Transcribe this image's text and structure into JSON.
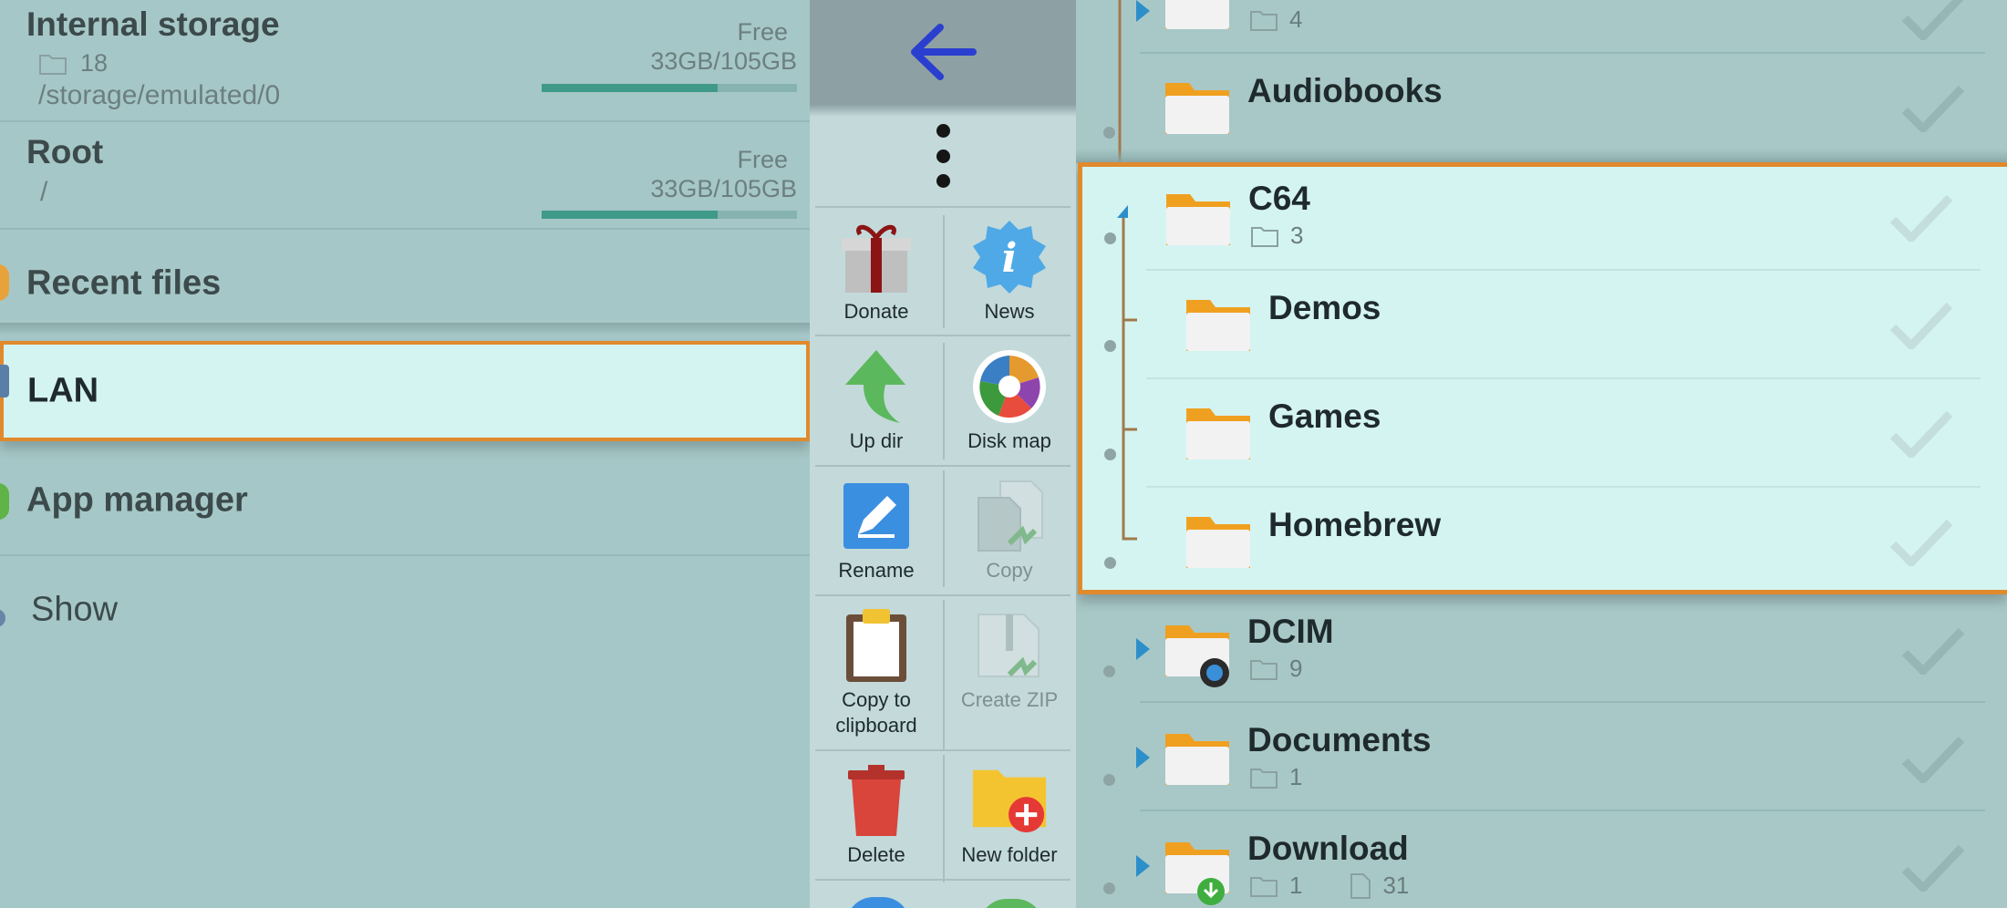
{
  "left_panel": {
    "internal_storage": {
      "title": "Internal storage",
      "folder_count": "18",
      "path": "/storage/emulated/0",
      "free_label": "Free",
      "size": "33GB/105GB",
      "usage_fraction": 0.69
    },
    "root": {
      "title": "Root",
      "path": "/",
      "free_label": "Free",
      "size": "33GB/105GB",
      "usage_fraction": 0.69
    },
    "items": {
      "recent_files": "Recent files",
      "lan": "LAN",
      "app_manager": "App manager",
      "show": "Show"
    }
  },
  "toolbar": {
    "donate": "Donate",
    "news": "News",
    "up_dir": "Up dir",
    "disk_map": "Disk map",
    "rename": "Rename",
    "copy": "Copy",
    "copy_to_clipboard_1": "Copy to",
    "copy_to_clipboard_2": "clipboard",
    "create_zip": "Create ZIP",
    "delete": "Delete",
    "new_folder": "New folder"
  },
  "files": {
    "top_partial": {
      "count": "4"
    },
    "audiobooks": {
      "name": "Audiobooks"
    },
    "c64": {
      "name": "C64",
      "count": "3"
    },
    "demos": {
      "name": "Demos"
    },
    "games": {
      "name": "Games"
    },
    "homebrew": {
      "name": "Homebrew"
    },
    "dcim": {
      "name": "DCIM",
      "count": "9"
    },
    "documents": {
      "name": "Documents",
      "count": "1"
    },
    "download": {
      "name": "Download",
      "folder_count": "1",
      "file_count": "31"
    }
  },
  "colors": {
    "accent_border": "#e08a2c",
    "selected_bg": "#d4f4f2",
    "panel_bg": "#a8c8c8",
    "back_arrow": "#2a3fcf"
  }
}
